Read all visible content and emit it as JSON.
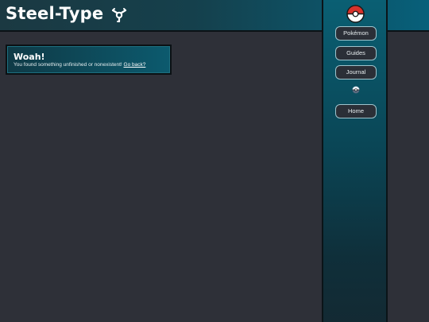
{
  "header": {
    "title": "Steel-Type",
    "icon": "steel-type-icon"
  },
  "sidebar": {
    "logo_icon": "pokeball-icon",
    "nav": [
      {
        "label": "Pokémon"
      },
      {
        "label": "Guides"
      },
      {
        "label": "Journal"
      }
    ],
    "divider_icon": "mini-pokeball-icon",
    "home_label": "Home"
  },
  "alert": {
    "title": "Woah!",
    "message": "You found something unfinished or nonexistent! ",
    "link_text": "Go back?"
  },
  "colors": {
    "background": "#2e3038",
    "accent": "#07607a",
    "button_border": "#9ec3cc"
  }
}
